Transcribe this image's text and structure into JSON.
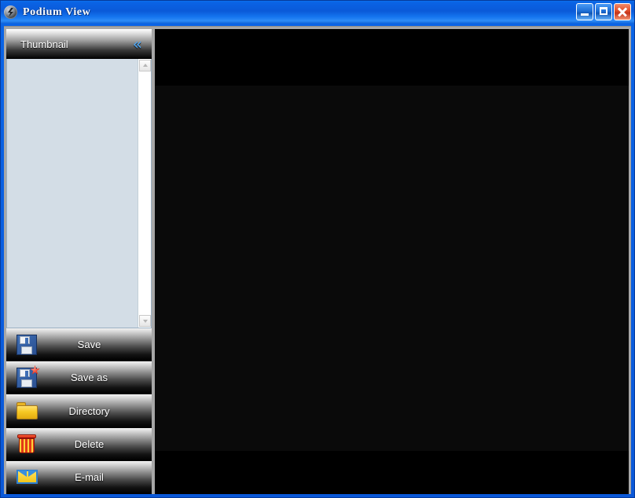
{
  "window": {
    "title": "Podium View",
    "app_icon": "podium-view-icon",
    "controls": {
      "minimize": "minimize-button",
      "maximize": "maximize-button",
      "close": "close-button"
    },
    "frame_color": "#0a5ed9"
  },
  "sidebar": {
    "header": {
      "label": "Thumbnail",
      "collapse_icon": "«"
    },
    "thumbnail_list": {
      "items": [],
      "background_color": "#d3dde6",
      "scrollbar": {
        "up_arrow": "scroll-up-arrow",
        "down_arrow": "scroll-down-arrow"
      }
    },
    "buttons": [
      {
        "label": "Save",
        "icon": "floppy-disk-icon"
      },
      {
        "label": "Save as",
        "icon": "floppy-disk-star-icon"
      },
      {
        "label": "Directory",
        "icon": "folder-icon"
      },
      {
        "label": "Delete",
        "icon": "trash-can-icon"
      },
      {
        "label": "E-mail",
        "icon": "envelope-icon"
      }
    ]
  },
  "viewer": {
    "state": "no-signal",
    "background_color": "#0a0a0a",
    "letterbox_color": "#000000"
  }
}
